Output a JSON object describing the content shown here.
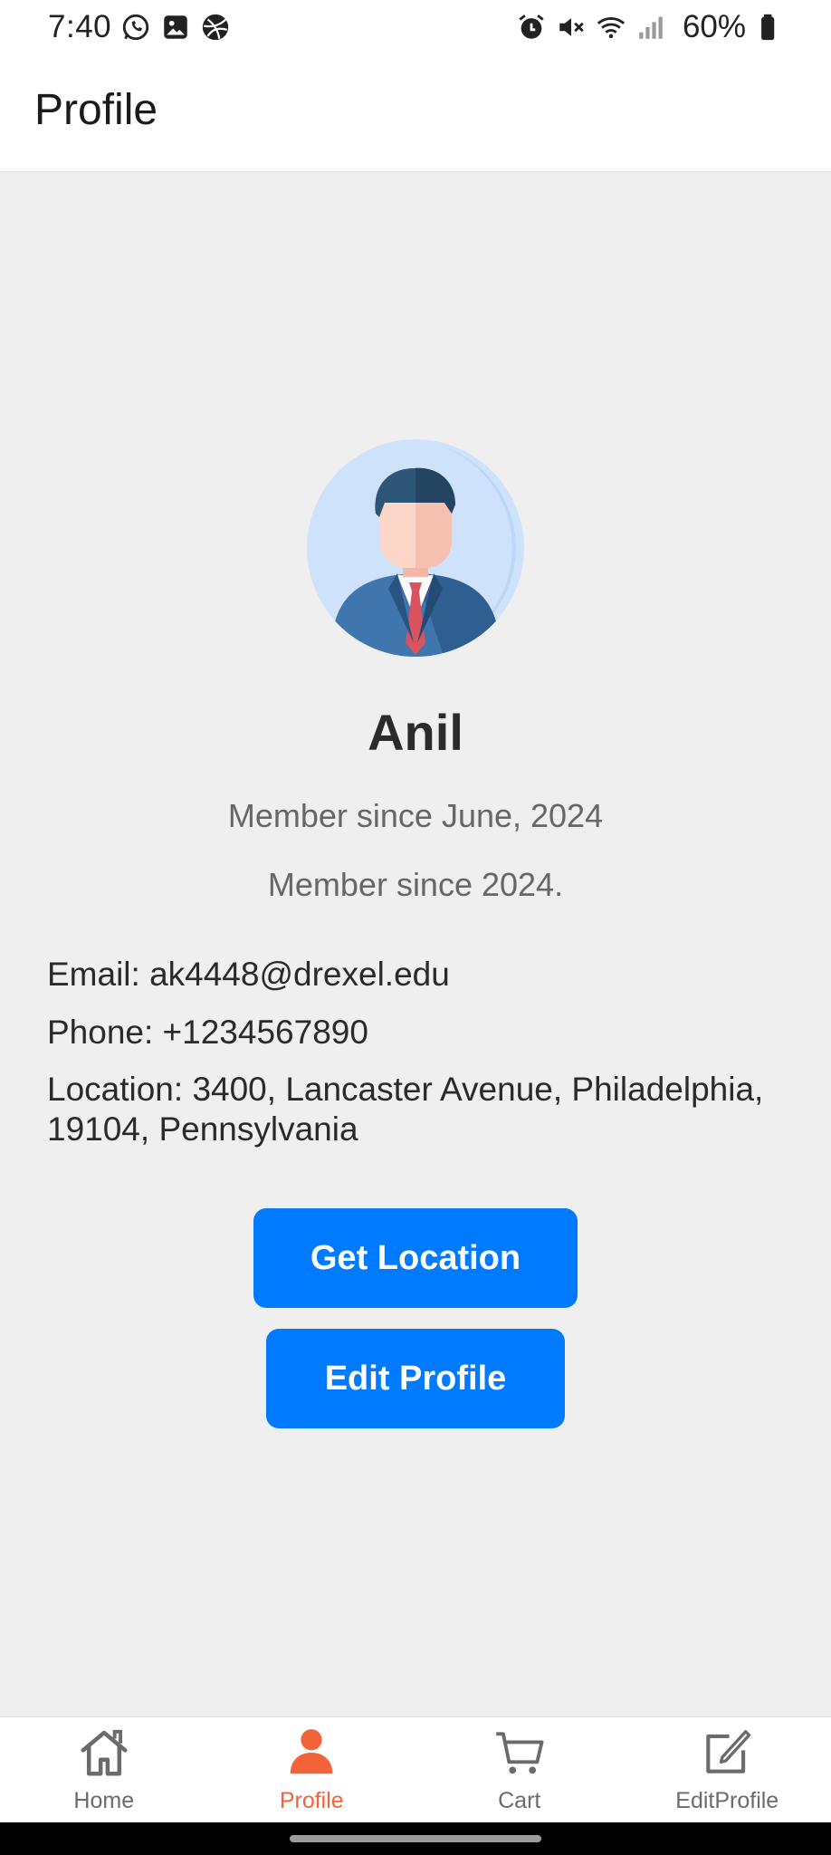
{
  "status_bar": {
    "time": "7:40",
    "left_icons": [
      "whatsapp-icon",
      "gallery-icon",
      "dribbble-icon"
    ],
    "right_icons": [
      "alarm-icon",
      "mute-icon",
      "wifi-icon",
      "signal-icon"
    ],
    "battery": "60%"
  },
  "header": {
    "title": "Profile"
  },
  "profile": {
    "name": "Anil",
    "member_since_date": "Member since June, 2024",
    "member_since_year": "Member since 2024.",
    "email": "Email: ak4448@drexel.edu",
    "phone": "Phone: +1234567890",
    "location": "Location: 3400, Lancaster Avenue, Philadelphia, 19104, Pennsylvania"
  },
  "buttons": {
    "get_location": "Get Location",
    "edit_profile": "Edit Profile"
  },
  "tabs": [
    {
      "label": "Home",
      "icon": "home-icon",
      "active": false
    },
    {
      "label": "Profile",
      "icon": "person-icon",
      "active": true
    },
    {
      "label": "Cart",
      "icon": "cart-icon",
      "active": false
    },
    {
      "label": "EditProfile",
      "icon": "edit-icon",
      "active": false
    }
  ],
  "colors": {
    "accent_button": "#007bff",
    "active_tab": "#f4623a",
    "background": "#efefef"
  }
}
